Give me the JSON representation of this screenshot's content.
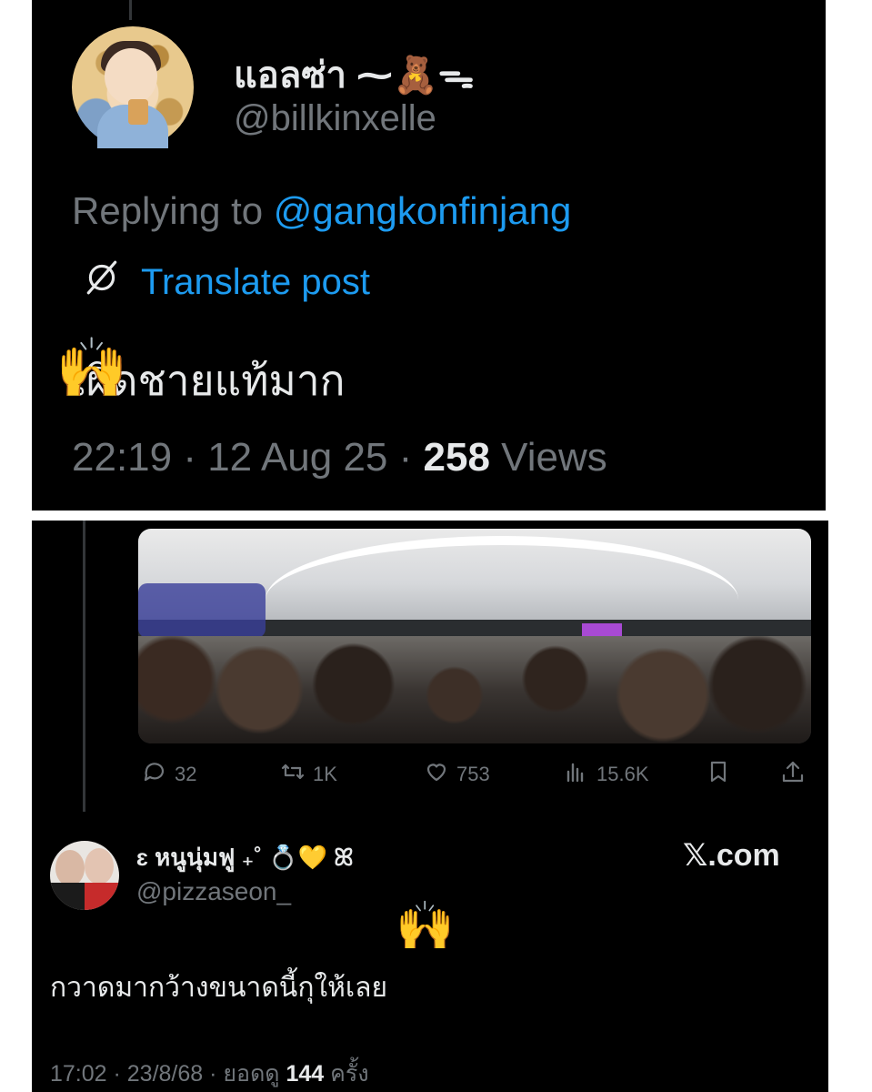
{
  "top_tweet": {
    "display_name": "แอลซ่า ⁓🧸ᯓ",
    "handle": "@billkinxelle",
    "replying_prefix": "Replying to",
    "replying_mention": "@gangkonfinjang",
    "translate_label": "Translate post",
    "text": "เผิดชายแท้มาก",
    "time": "22:19 · 12 Aug 25 · ",
    "views_count": "258",
    "views_label": " Views",
    "emoji_overlay": "🙌"
  },
  "bottom_tweet": {
    "actions": {
      "replies": "32",
      "reposts": "1K",
      "likes": "753",
      "views": "15.6K"
    },
    "display_name": "ɛ หนูนุ่มฟู ₊˚ 💍💛 ꕤ",
    "handle": "@pizzaseon_",
    "watermark": "𝕏.com",
    "text": "กวาดมากว้างขนาดนี้กุให้เลย",
    "emoji_overlay": "🙌",
    "meta_prefix": "17:02 · 23/8/68 · ยอดดู ",
    "meta_count": "144",
    "meta_suffix": " ครั้ง"
  },
  "colors": {
    "background": "#000000",
    "text_primary": "#e7e9ea",
    "text_secondary": "#71767b",
    "accent": "#1d9bf0"
  }
}
